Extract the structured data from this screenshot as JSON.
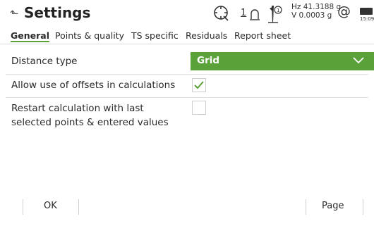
{
  "header": {
    "title": "Settings",
    "face_number": "1",
    "hz_reading": "Hz 41.3188 g",
    "v_reading": "V  0.0003 g",
    "at_symbol": "@",
    "battery_time": "15:09"
  },
  "tabs": [
    {
      "label": "General",
      "active": true
    },
    {
      "label": "Points & quality",
      "active": false
    },
    {
      "label": "TS specific",
      "active": false
    },
    {
      "label": "Residuals",
      "active": false
    },
    {
      "label": "Report sheet",
      "active": false
    }
  ],
  "settings": {
    "distance_type": {
      "label": "Distance type",
      "value": "Grid"
    },
    "allow_offsets": {
      "label": "Allow use of offsets in calculations",
      "checked": true
    },
    "restart_calc": {
      "label_line1": "Restart calculation with last",
      "label_line2": "selected points & entered values",
      "checked": false
    }
  },
  "softkeys": {
    "ok": "OK",
    "page": "Page"
  },
  "colors": {
    "accent": "#5aa13a",
    "dropdown_text": "#ffffff"
  },
  "icons": {
    "back": "back-arrow-icon",
    "target": "target-search-icon",
    "face": "face-indicator-icon",
    "prism": "prism-icon",
    "battery": "battery-icon",
    "dropdown": "chevron-down-icon",
    "check": "checkmark-icon"
  }
}
